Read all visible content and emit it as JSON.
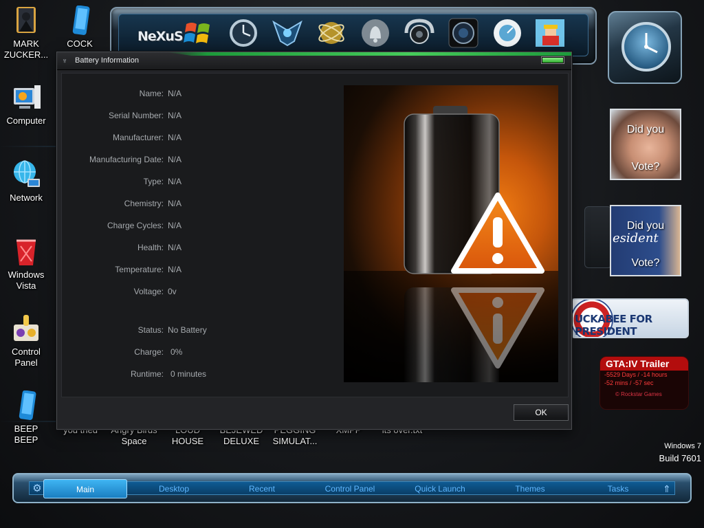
{
  "desktop": {
    "icons": [
      {
        "label": "MARK\nZUCKER...",
        "l1": "MARK",
        "l2": "ZUCKER...",
        "icon": "book-user-icon"
      },
      {
        "label": "COCK",
        "l1": "COCK",
        "l2": "",
        "icon": "blue-phone-icon"
      },
      {
        "label": "Computer",
        "l1": "Computer",
        "l2": "",
        "icon": "computer-icon"
      },
      {
        "label": "Network",
        "l1": "Network",
        "l2": "",
        "icon": "network-globe-icon"
      },
      {
        "label": "Windows Vista",
        "l1": "Windows",
        "l2": "Vista",
        "icon": "recycle-bin-icon"
      },
      {
        "label": "Control Panel",
        "l1": "Control",
        "l2": "Panel",
        "icon": "control-panel-icon"
      },
      {
        "label": "BEEP BEEP",
        "l1": "BEEP",
        "l2": "BEEP",
        "icon": "blue-phone-icon"
      }
    ],
    "bottom_row": [
      {
        "l1": "you tried",
        "l2": ""
      },
      {
        "l1": "Angry Birds",
        "l2": "Space"
      },
      {
        "l1": "LOUD",
        "l2": "HOUSE"
      },
      {
        "l1": "BEJEWED",
        "l2": "DELUXE"
      },
      {
        "l1": "PEGGING",
        "l2": "SIMULAT..."
      },
      {
        "l1": "XMPP",
        "l2": ""
      },
      {
        "l1": "its over.txt",
        "l2": ""
      }
    ]
  },
  "dock": {
    "logo": "NeXuS",
    "items": [
      "windows-logo-icon",
      "clock-icon",
      "shield-emblem-icon",
      "atom-icon",
      "bell-icon",
      "webcam-icon",
      "camera-lens-icon",
      "gauge-icon",
      "cartoon-icon"
    ]
  },
  "widgets": {
    "vote1": {
      "line1": "Did you",
      "line2": "Vote?"
    },
    "vote2": {
      "line1": "Did you",
      "line2": "Vote?",
      "bg_text": "esident"
    },
    "huckabee": "UCKABEE FOR PRESIDENT",
    "gta": {
      "title": "GTA:IV Trailer",
      "line1": "-5529 Days / -14 hours",
      "line2": "-52 mins / -57 sec",
      "footer": "© Rockstar Games"
    },
    "os_name": "Windows 7",
    "os_build": "Build 7601"
  },
  "taskbar": {
    "tabs": [
      "Main",
      "Desktop",
      "Recent",
      "Control Panel",
      "Quick Launch",
      "Themes",
      "Tasks"
    ],
    "active": "Main"
  },
  "dialog": {
    "title": "Battery Information",
    "properties": [
      {
        "label": "Name:",
        "value": "N/A"
      },
      {
        "label": "Serial Number:",
        "value": "N/A"
      },
      {
        "label": "Manufacturer:",
        "value": "N/A"
      },
      {
        "label": "Manufacturing Date:",
        "value": "N/A"
      },
      {
        "label": "Type:",
        "value": "N/A"
      },
      {
        "label": "Chemistry:",
        "value": "N/A"
      },
      {
        "label": "Charge Cycles:",
        "value": "N/A"
      },
      {
        "label": "Health:",
        "value": "N/A"
      },
      {
        "label": "Temperature:",
        "value": "N/A"
      },
      {
        "label": "Voltage:",
        "value": "0v"
      }
    ],
    "status": [
      {
        "label": "Status:",
        "value": "No Battery"
      },
      {
        "label": "Charge:",
        "value": "0%"
      },
      {
        "label": "Runtime:",
        "value": "0 minutes"
      }
    ],
    "ok_label": "OK",
    "image_icon": "battery-warning-icon"
  },
  "colors": {
    "dialog_bg": "#232427",
    "accent_green": "#46cc5a",
    "warning_orange": "#e8700d",
    "taskbar_blue": "#0e5b93"
  }
}
